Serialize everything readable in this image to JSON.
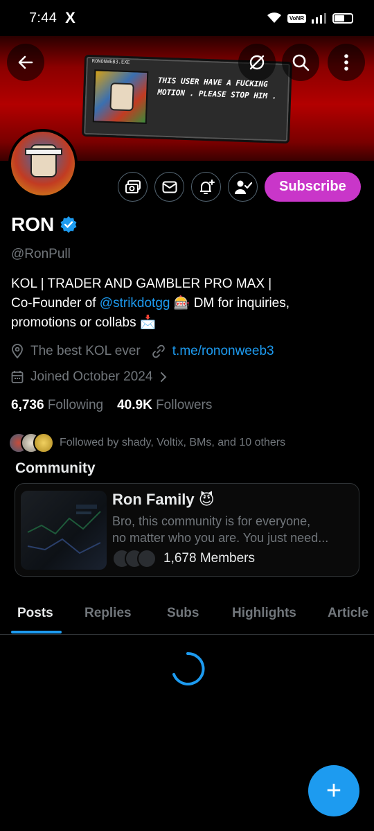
{
  "status_bar": {
    "time": "7:44",
    "app_icon": "X",
    "network_badge": "VoNR",
    "battery_percent": 0.55
  },
  "banner": {
    "window_title": "RONONWEB3.EXE",
    "message": "THIS USER HAVE A FUCKING MOTION . PLEASE STOP HIM ."
  },
  "header_actions": {
    "back": "←",
    "mute": "∅",
    "search": "⌕",
    "more": "⋮"
  },
  "profile": {
    "display_name": "RON",
    "handle": "@RonPull",
    "bio_line1": "KOL | TRADER AND GAMBLER PRO MAX |",
    "bio_line2_prefix": "Co-Founder of ",
    "bio_mention": "@strikdotgg",
    "bio_emoji1": "🎰",
    "bio_line2_suffix": " DM for inquiries,",
    "bio_line3": "promotions or collabs ",
    "bio_emoji2": "📩",
    "location": "The best KOL ever",
    "website": "t.me/rononweeb3",
    "joined": "Joined October 2024",
    "following_count": "6,736",
    "following_label": "Following",
    "followers_count": "40.9K",
    "followers_label": "Followers",
    "followed_by": "Followed by shady, Voltix, BMs, and 10 others"
  },
  "actions": {
    "subscribe": "Subscribe"
  },
  "community": {
    "section_title": "Community",
    "name": "Ron Family",
    "emoji": "😈",
    "description_line1": "Bro, this community is for everyone,",
    "description_line2": "no matter who you are. You just need...",
    "members": "1,678 Members"
  },
  "tabs": [
    {
      "label": "Posts",
      "active": true
    },
    {
      "label": "Replies",
      "active": false
    },
    {
      "label": "Subs",
      "active": false
    },
    {
      "label": "Highlights",
      "active": false
    },
    {
      "label": "Article",
      "active": false
    }
  ],
  "fab": {
    "label": "+"
  },
  "colors": {
    "accent": "#1d9bf0",
    "subscribe": "#c936c9",
    "muted_text": "#71767b",
    "banner_red": "#b30000"
  }
}
